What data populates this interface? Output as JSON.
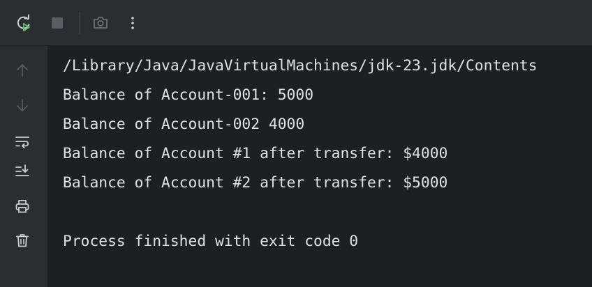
{
  "toolbar": {
    "buttons": [
      {
        "name": "rerun-icon",
        "icon": "rerun"
      },
      {
        "name": "stop-icon",
        "icon": "stop"
      },
      {
        "name": "screenshot-icon",
        "icon": "camera"
      },
      {
        "name": "more-options-icon",
        "icon": "kebab"
      }
    ]
  },
  "gutter": {
    "buttons": [
      {
        "name": "scroll-up-icon",
        "icon": "arrow-up"
      },
      {
        "name": "scroll-down-icon",
        "icon": "arrow-down"
      },
      {
        "name": "soft-wrap-icon",
        "icon": "soft-wrap"
      },
      {
        "name": "scroll-to-end-icon",
        "icon": "scroll-to-end"
      },
      {
        "name": "print-icon",
        "icon": "printer"
      },
      {
        "name": "clear-all-icon",
        "icon": "trash"
      }
    ]
  },
  "console": {
    "lines": [
      "/Library/Java/JavaVirtualMachines/jdk-23.jdk/Contents",
      "Balance of Account-001: 5000",
      "Balance of Account-002 4000",
      "Balance of Account #1 after transfer: $4000",
      "Balance of Account #2 after transfer: $5000",
      "",
      "Process finished with exit code 0"
    ]
  },
  "colors": {
    "background": "#1e1f22",
    "panel": "#2b2d30",
    "text": "#dfe1e5",
    "icon": "#ced0d6",
    "icon_disabled": "#5a5d63",
    "run_green": "#5fb865"
  }
}
